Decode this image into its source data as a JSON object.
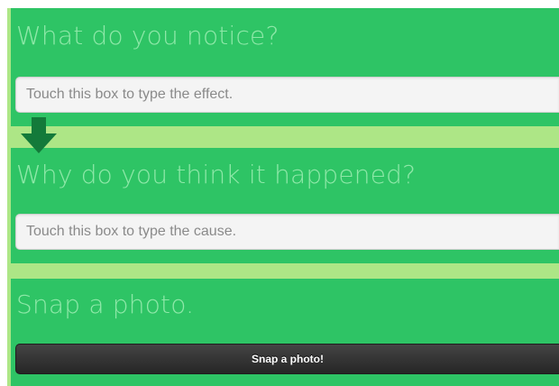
{
  "effect_section": {
    "heading": "What do you notice?",
    "input_placeholder": "Touch this box to type the effect."
  },
  "cause_section": {
    "heading": "Why do you think it happened?",
    "input_placeholder": "Touch this box to type the cause."
  },
  "photo_section": {
    "heading": "Snap a photo.",
    "button_label": "Snap a photo!"
  },
  "colors": {
    "section_background": "#2ec465",
    "divider": "#ade686",
    "heading_text": "#8ee8a8",
    "arrow": "#137a3a",
    "button": "#2f2f2f"
  },
  "icons": {
    "flow_arrow": "arrow-down-icon"
  }
}
